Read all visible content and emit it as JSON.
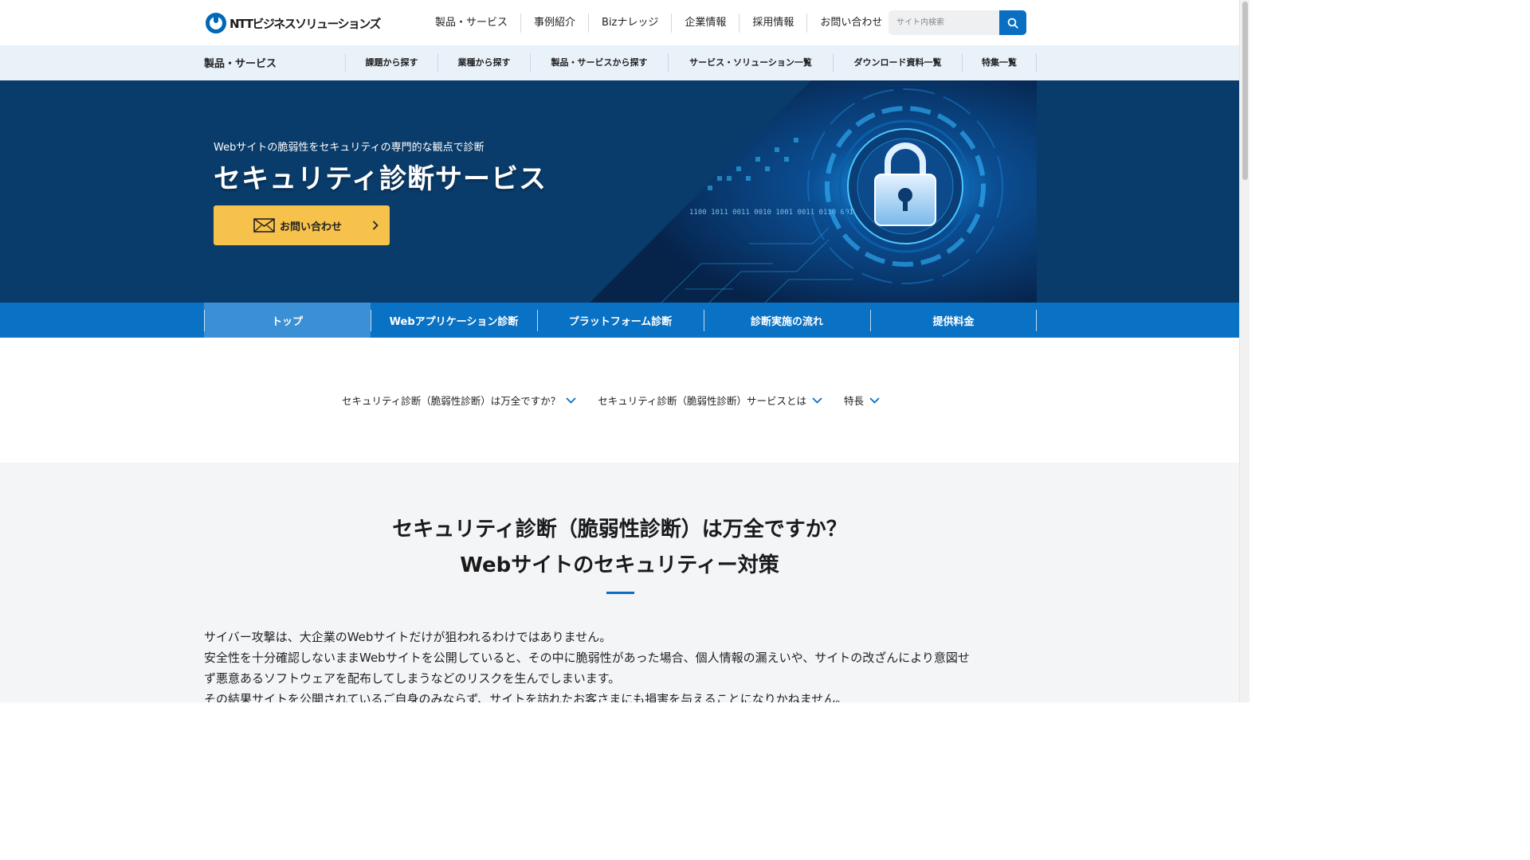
{
  "brand": {
    "logo_text": "NTTビジネスソリューションズ"
  },
  "global_nav": [
    "製品・サービス",
    "事例紹介",
    "Bizナレッジ",
    "企業情報",
    "採用情報",
    "お問い合わせ"
  ],
  "search": {
    "placeholder": "サイト内検索",
    "value": ""
  },
  "subnav": {
    "title": "製品・サービス",
    "items": [
      "課題から探す",
      "業種から探す",
      "製品・サービスから探す",
      "サービス・ソリューション一覧",
      "ダウンロード資料一覧",
      "特集一覧"
    ]
  },
  "hero": {
    "subtitle": "Webサイトの脆弱性をセキュリティの専門的な観点で診断",
    "title": "セキュリティ診断サービス",
    "cta_label": "お問い合わせ",
    "binary_text": "1100 1011 0011 0010 1001 0011 0110 0011"
  },
  "local_nav": {
    "tabs": [
      "トップ",
      "Webアプリケーション診断",
      "プラットフォーム診断",
      "診断実施の流れ",
      "提供料金"
    ],
    "active_index": 0
  },
  "anchors": [
    "セキュリティ診断（脆弱性診断）は万全ですか？",
    "セキュリティ診断（脆弱性診断）サービスとは",
    "特長"
  ],
  "section": {
    "title_line1": "セキュリティ診断（脆弱性診断）は万全ですか？",
    "title_line2": "Webサイトのセキュリティー対策",
    "paragraphs": [
      "サイバー攻撃は、大企業のWebサイトだけが狙われるわけではありません。",
      "安全性を十分確認しないままWebサイトを公開していると、その中に脆弱性があった場合、個人情報の漏えいや、サイトの改ざんにより意図せ",
      "ず悪意あるソフトウェアを配布してしまうなどのリスクを生んでしまいます。",
      "その結果サイトを公開されているご自身のみならず、サイトを訪れたお客さまにも損害を与えることになりかねません。"
    ]
  },
  "colors": {
    "primary_blue": "#0a72c4",
    "hero_navy": "#093c6a",
    "cta_yellow": "#f6c24b",
    "subnav_bg": "#e9f1f9",
    "content_bg": "#f4f5f7"
  },
  "icons": [
    "search-icon",
    "mail-icon",
    "chevron-right-icon",
    "chevron-down-icon",
    "padlock-icon"
  ]
}
